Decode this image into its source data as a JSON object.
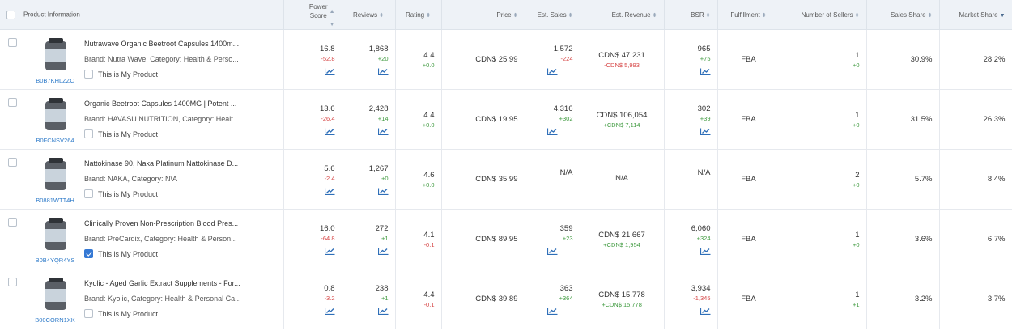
{
  "headers": {
    "product": "Product Information",
    "power": [
      "Power",
      "Score"
    ],
    "reviews": "Reviews",
    "rating": "Rating",
    "price": "Price",
    "sales": "Est. Sales",
    "revenue": "Est. Revenue",
    "bsr": "BSR",
    "fulfillment": "Fulfillment",
    "sellers": "Number of Sellers",
    "sales_share": "Sales Share",
    "market_share": "Market Share"
  },
  "my_product_label": "This is My Product",
  "rows": [
    {
      "title": "Nutrawave Organic Beetroot Capsules 1400m...",
      "brand": "Brand: Nutra Wave,  Category: Health & Perso...",
      "asin": "B0B7KHLZZC",
      "mine": false,
      "power": "16.8",
      "power_d": "-52.8",
      "reviews": "1,868",
      "reviews_d": "+20",
      "rating": "4.4",
      "rating_d": "+0.0",
      "price": "CDN$ 25.99",
      "sales": "1,572",
      "sales_d": "-224",
      "revenue": "CDN$ 47,231",
      "revenue_d": "-CDN$ 5,993",
      "bsr": "965",
      "bsr_d": "+75",
      "fulfillment": "FBA",
      "sellers": "1",
      "sellers_d": "+0",
      "sales_share": "30.9%",
      "market_share": "28.2%"
    },
    {
      "title": "Organic Beetroot Capsules 1400MG | Potent ...",
      "brand": "Brand: HAVASU NUTRITION,  Category: Healt...",
      "asin": "B0FCNSV264",
      "mine": false,
      "power": "13.6",
      "power_d": "-26.4",
      "reviews": "2,428",
      "reviews_d": "+14",
      "rating": "4.4",
      "rating_d": "+0.0",
      "price": "CDN$ 19.95",
      "sales": "4,316",
      "sales_d": "+302",
      "revenue": "CDN$ 106,054",
      "revenue_d": "+CDN$ 7,114",
      "bsr": "302",
      "bsr_d": "+39",
      "fulfillment": "FBA",
      "sellers": "1",
      "sellers_d": "+0",
      "sales_share": "31.5%",
      "market_share": "26.3%"
    },
    {
      "title": "Nattokinase 90, Naka Platinum Nattokinase D...",
      "brand": "Brand: NAKA,  Category: N\\A",
      "asin": "B0881WTT4H",
      "mine": false,
      "power": "5.6",
      "power_d": "-2.4",
      "reviews": "1,267",
      "reviews_d": "+0",
      "rating": "4.6",
      "rating_d": "+0.0",
      "price": "CDN$ 35.99",
      "sales": "N/A",
      "sales_d": "",
      "revenue": "N/A",
      "revenue_d": "",
      "bsr": "N/A",
      "bsr_d": "",
      "fulfillment": "FBA",
      "sellers": "2",
      "sellers_d": "+0",
      "sales_share": "5.7%",
      "market_share": "8.4%"
    },
    {
      "title": "Clinically Proven Non-Prescription Blood Pres...",
      "brand": "Brand: PreCardix,  Category: Health & Person...",
      "asin": "B0B4YQR4YS",
      "mine": true,
      "power": "16.0",
      "power_d": "-64.8",
      "reviews": "272",
      "reviews_d": "+1",
      "rating": "4.1",
      "rating_d": "-0.1",
      "price": "CDN$ 89.95",
      "sales": "359",
      "sales_d": "+23",
      "revenue": "CDN$ 21,667",
      "revenue_d": "+CDN$ 1,954",
      "bsr": "6,060",
      "bsr_d": "+324",
      "fulfillment": "FBA",
      "sellers": "1",
      "sellers_d": "+0",
      "sales_share": "3.6%",
      "market_share": "6.7%"
    },
    {
      "title": "Kyolic - Aged Garlic Extract Supplements - For...",
      "brand": "Brand: Kyolic,  Category: Health & Personal Ca...",
      "asin": "B00CORN1XK",
      "mine": false,
      "power": "0.8",
      "power_d": "-3.2",
      "reviews": "238",
      "reviews_d": "+1",
      "rating": "4.4",
      "rating_d": "-0.1",
      "price": "CDN$ 39.89",
      "sales": "363",
      "sales_d": "+364",
      "revenue": "CDN$ 15,778",
      "revenue_d": "+CDN$ 15,778",
      "bsr": "3,934",
      "bsr_d": "-1,345",
      "fulfillment": "FBA",
      "sellers": "1",
      "sellers_d": "+1",
      "sales_share": "3.2%",
      "market_share": "3.7%"
    }
  ]
}
